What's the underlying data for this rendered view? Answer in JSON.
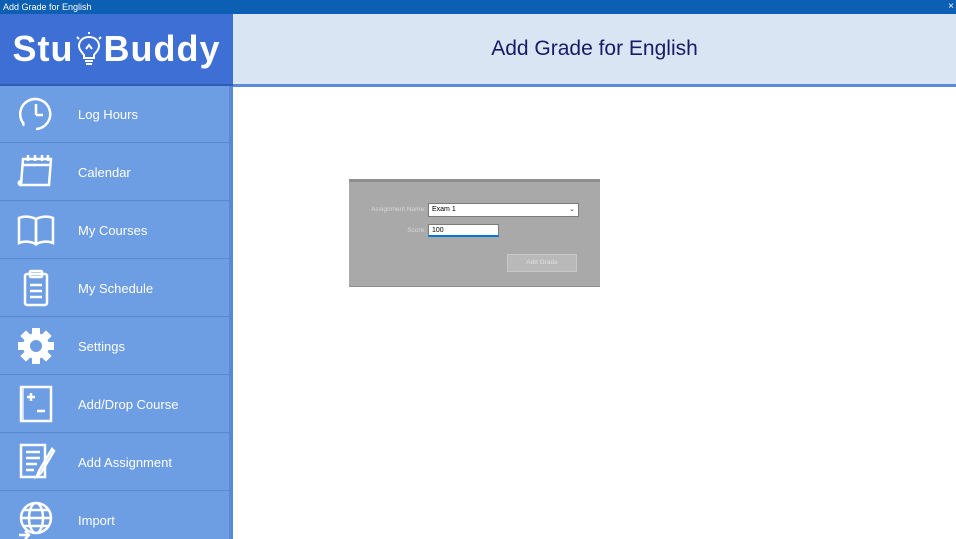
{
  "window": {
    "title": "Add Grade for English",
    "close_glyph": "×"
  },
  "logo": {
    "prefix": "Stu",
    "suffix": "Buddy"
  },
  "sidebar": {
    "items": [
      {
        "label": "Log Hours",
        "icon": "clock-icon"
      },
      {
        "label": "Calendar",
        "icon": "calendar-icon"
      },
      {
        "label": "My Courses",
        "icon": "book-icon"
      },
      {
        "label": "My Schedule",
        "icon": "clipboard-icon"
      },
      {
        "label": "Settings",
        "icon": "gear-icon"
      },
      {
        "label": "Add/Drop Course",
        "icon": "plus-minus-icon"
      },
      {
        "label": "Add Assignment",
        "icon": "document-pen-icon"
      },
      {
        "label": "Import",
        "icon": "globe-icon"
      }
    ]
  },
  "header": {
    "title": "Add Grade for English"
  },
  "form": {
    "assignment_label": "Assignment Name:",
    "assignment_value": "Exam 1",
    "score_label": "Score:",
    "score_value": "100",
    "submit_label": "Add Grade"
  },
  "colors": {
    "titlebar": "#0c5fb3",
    "sidebar": "#6d9de3",
    "logo_bg": "#3d6fd4",
    "header_bg": "#d9e5f3",
    "header_text": "#1a1a66",
    "panel_bg": "#a9a9a9"
  }
}
